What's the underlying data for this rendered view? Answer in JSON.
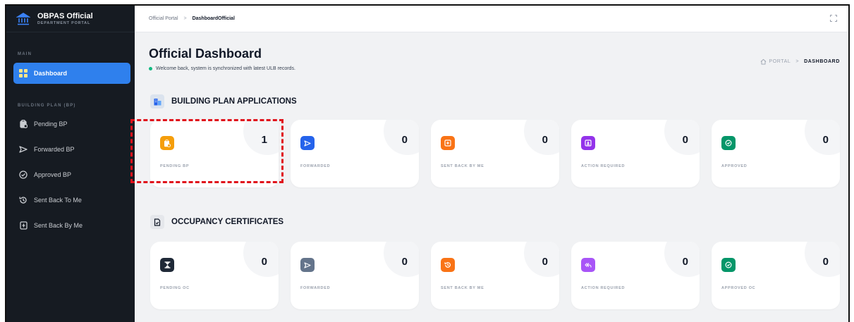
{
  "brand": {
    "title": "OBPAS Official",
    "subtitle": "DEPARTMENT PORTAL"
  },
  "sidebar": {
    "main_label": "MAIN",
    "dashboard": "Dashboard",
    "bp_label": "BUILDING PLAN (BP)",
    "items": [
      {
        "label": "Pending BP",
        "icon": "clipboard-clock-icon"
      },
      {
        "label": "Forwarded BP",
        "icon": "send-icon"
      },
      {
        "label": "Approved BP",
        "icon": "check-circle-icon"
      },
      {
        "label": "Sent Back To Me",
        "icon": "history-icon"
      },
      {
        "label": "Sent Back By Me",
        "icon": "return-box-icon"
      }
    ]
  },
  "topbar": {
    "crumb1": "Official Portal",
    "sep": ">",
    "crumb2": "DashboardOfficial"
  },
  "header": {
    "title": "Official Dashboard",
    "welcome": "Welcome back, system is synchronized with latest ULB records.",
    "crumb_portal": "PORTAL",
    "crumb_sep": ">",
    "crumb_current": "DASHBOARD"
  },
  "bp": {
    "title": "BUILDING PLAN APPLICATIONS",
    "cards": [
      {
        "label": "PENDING BP",
        "count": "1",
        "color": "#f59e0b"
      },
      {
        "label": "FORWARDED",
        "count": "0",
        "color": "#2563eb"
      },
      {
        "label": "SENT BACK BY ME",
        "count": "0",
        "color": "#f97316"
      },
      {
        "label": "ACTION REQUIRED",
        "count": "0",
        "color": "#9333ea"
      },
      {
        "label": "APPROVED",
        "count": "0",
        "color": "#059669"
      }
    ]
  },
  "oc": {
    "title": "OCCUPANCY CERTIFICATES",
    "cards": [
      {
        "label": "PENDING OC",
        "count": "0",
        "color": "#1f2937"
      },
      {
        "label": "FORWARDED",
        "count": "0",
        "color": "#64748b"
      },
      {
        "label": "SENT BACK BY ME",
        "count": "0",
        "color": "#f97316"
      },
      {
        "label": "ACTION REQUIRED",
        "count": "0",
        "color": "#a855f7"
      },
      {
        "label": "APPROVED OC",
        "count": "0",
        "color": "#059669"
      }
    ]
  },
  "colors": {
    "sidebar_bg": "#161b22",
    "accent": "#2f80ed",
    "highlight": "#e0121b"
  }
}
